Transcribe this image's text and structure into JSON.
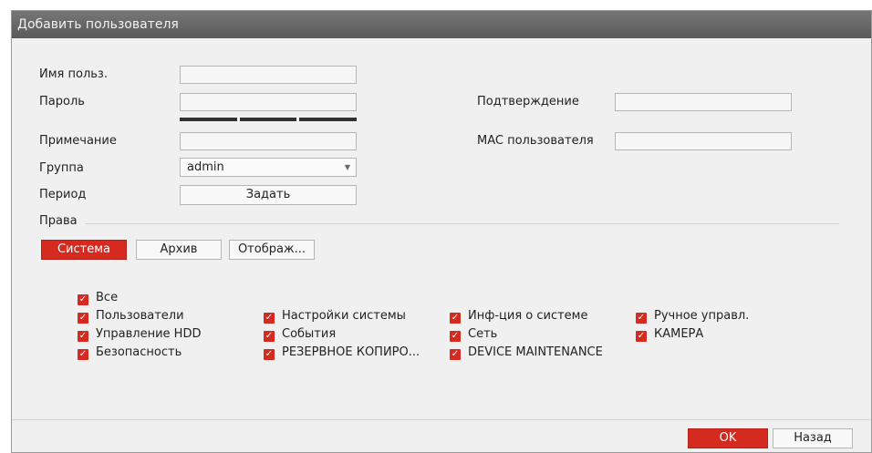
{
  "dialog": {
    "title": "Добавить пользователя",
    "fields": {
      "username_label": "Имя польз.",
      "password_label": "Пароль",
      "confirm_label": "Подтверждение",
      "note_label": "Примечание",
      "mac_label": "MAC пользователя",
      "group_label": "Группа",
      "group_value": "admin",
      "period_label": "Период",
      "period_button": "Задать"
    },
    "rights": {
      "label": "Права",
      "tabs": [
        "Система",
        "Архив",
        "Отображ..."
      ],
      "active_tab": "Система",
      "checkboxes": {
        "all": "Все",
        "col1": [
          "Пользователи",
          "Управление HDD",
          "Безопасность"
        ],
        "col2": [
          "Настройки системы",
          "События",
          "РЕЗЕРВНОЕ КОПИРО..."
        ],
        "col3": [
          "Инф-ция о системе",
          "Сеть",
          "DEVICE MAINTENANCE"
        ],
        "col4": [
          "Ручное управл.",
          "КАМЕРА"
        ]
      }
    },
    "buttons": {
      "ok": "OK",
      "back": "Назад"
    },
    "colors": {
      "accent": "#d42a1f",
      "titlebar": "#666666"
    }
  }
}
